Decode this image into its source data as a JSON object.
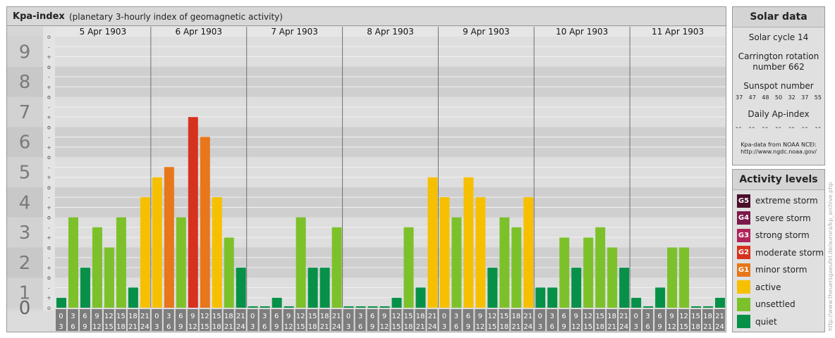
{
  "chart_data": {
    "type": "bar",
    "title": "Kpa-index",
    "subtitle": "(planetary 3-hourly index of geomagnetic activity)",
    "ylim": [
      0,
      9
    ],
    "y_major_ticks": [
      "0",
      "1",
      "2",
      "3",
      "4",
      "5",
      "6",
      "7",
      "8",
      "9"
    ],
    "y_minor_marks": [
      "o",
      "+",
      "-"
    ],
    "days": [
      "5 Apr 1903",
      "6 Apr 1903",
      "7 Apr 1903",
      "8 Apr 1903",
      "9 Apr 1903",
      "10 Apr 1903",
      "11 Apr 1903"
    ],
    "interval_start": [
      "0",
      "3",
      "6",
      "9",
      "12",
      "15",
      "18",
      "21"
    ],
    "interval_end": [
      "3",
      "6",
      "9",
      "12",
      "15",
      "18",
      "21",
      "24"
    ],
    "values": [
      0.33,
      3.0,
      1.33,
      2.67,
      2.0,
      3.0,
      0.67,
      3.67,
      4.33,
      4.67,
      3.0,
      6.33,
      5.67,
      3.67,
      2.33,
      1.33,
      0.0,
      0.0,
      0.33,
      0.0,
      3.0,
      1.33,
      1.33,
      2.67,
      0.0,
      0.0,
      0.0,
      0.0,
      0.33,
      2.67,
      0.67,
      4.33,
      3.67,
      3.0,
      4.33,
      3.67,
      1.33,
      3.0,
      2.67,
      3.67,
      0.67,
      0.67,
      2.33,
      1.33,
      2.33,
      2.67,
      2.0,
      1.33,
      0.33,
      0.0,
      0.67,
      2.0,
      2.0,
      0.0,
      0.0,
      0.33
    ],
    "colors": {
      "extreme": "#4a0f2a",
      "severe": "#7a1a4a",
      "strong": "#b0235a",
      "moderate": "#d6321e",
      "minor": "#e8761a",
      "active": "#f6c000",
      "unsettled": "#7cc12a",
      "quiet": "#079048"
    }
  },
  "solar": {
    "heading": "Solar data",
    "cycle": "Solar cycle 14",
    "carrington_1": "Carrington rotation",
    "carrington_2": "number 662",
    "sunspot_heading": "Sunspot number",
    "sunspots": [
      "37",
      "47",
      "48",
      "50",
      "32",
      "37",
      "55"
    ],
    "ap_heading": "Daily Ap-index",
    "ap_values": [
      "--",
      "--",
      "--",
      "--",
      "--",
      "--",
      "--"
    ],
    "credit_1": "Kpa-data from NOAA NCEI:",
    "credit_2": "http://www.ngdc.noaa.gov/"
  },
  "activity": {
    "heading": "Activity levels",
    "levels": [
      {
        "code": "G5",
        "label": "extreme storm",
        "color": "#4a0f2a"
      },
      {
        "code": "G4",
        "label": "severe storm",
        "color": "#7a1a4a"
      },
      {
        "code": "G3",
        "label": "strong storm",
        "color": "#b0235a"
      },
      {
        "code": "G2",
        "label": "moderate storm",
        "color": "#d6321e"
      },
      {
        "code": "G1",
        "label": "minor storm",
        "color": "#e8761a"
      },
      {
        "code": "",
        "label": "active",
        "color": "#f6c000"
      },
      {
        "code": "",
        "label": "unsettled",
        "color": "#7cc12a"
      },
      {
        "code": "",
        "label": "quiet",
        "color": "#079048"
      }
    ]
  },
  "watermark": "http://www.theuersgaeufel.de/aurora/kp_archive.php"
}
